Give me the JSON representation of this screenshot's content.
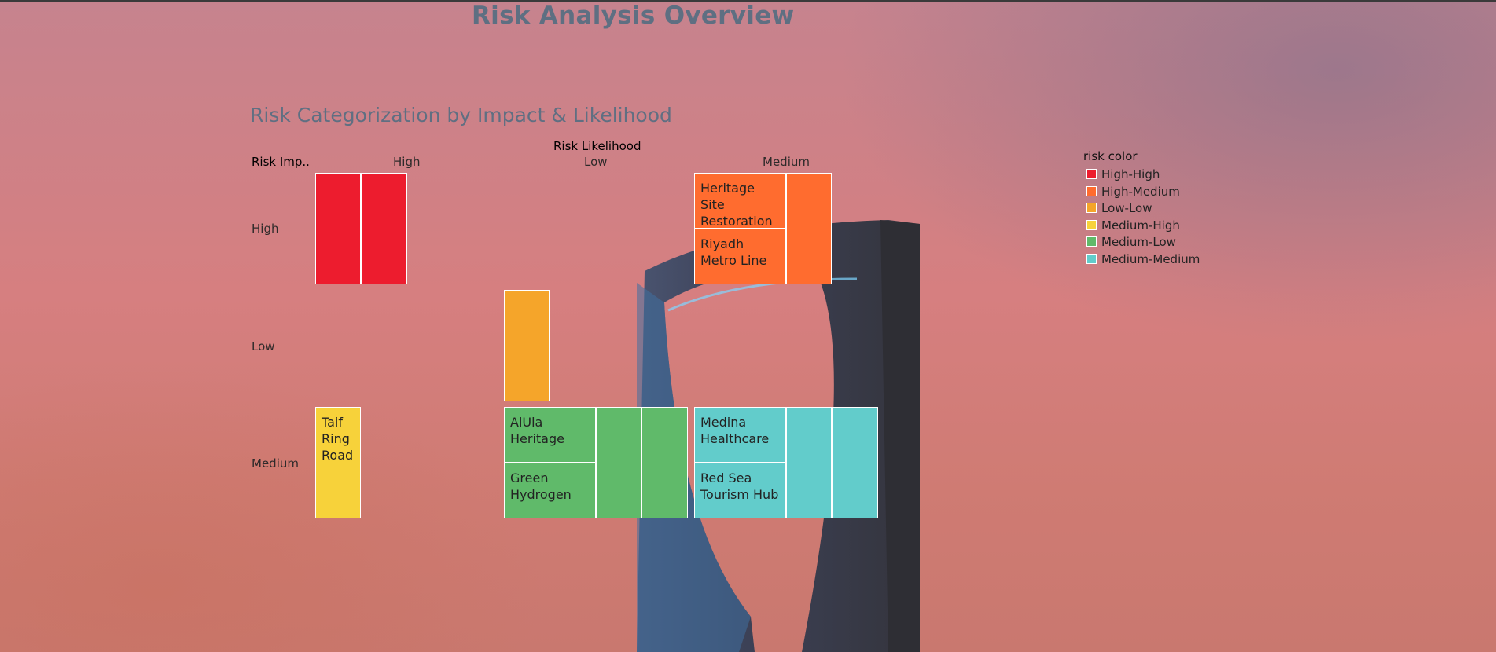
{
  "page": {
    "title": "Risk Analysis Overview"
  },
  "colors": {
    "High-High": "#ed1c2e",
    "High-Medium": "#ff6c2f",
    "Low-Low": "#f5a52a",
    "Medium-High": "#f7d23a",
    "Medium-Low": "#60ba6a",
    "Medium-Medium": "#62cccb"
  },
  "chart_data": {
    "type": "treemap",
    "title": "Risk Categorization by Impact & Likelihood",
    "column_header": "Risk Likelihood",
    "row_header": "Risk Imp..",
    "columns": [
      "High",
      "Low",
      "Medium"
    ],
    "rows": [
      "High",
      "Low",
      "Medium"
    ],
    "cells": [
      {
        "impact": "High",
        "likelihood": "High",
        "color": "High-High",
        "items": [
          {
            "label": ""
          },
          {
            "label": ""
          }
        ]
      },
      {
        "impact": "High",
        "likelihood": "Medium",
        "color": "High-Medium",
        "items": [
          {
            "label": "Heritage Site Restoration"
          },
          {
            "label": "Riyadh Metro Line"
          },
          {
            "label": ""
          }
        ]
      },
      {
        "impact": "Low",
        "likelihood": "Low",
        "color": "Low-Low",
        "items": [
          {
            "label": ""
          }
        ]
      },
      {
        "impact": "Medium",
        "likelihood": "High",
        "color": "Medium-High",
        "items": [
          {
            "label": "Taif Ring Road"
          }
        ]
      },
      {
        "impact": "Medium",
        "likelihood": "Low",
        "color": "Medium-Low",
        "items": [
          {
            "label": "AlUla Heritage"
          },
          {
            "label": "Green Hydrogen"
          },
          {
            "label": ""
          },
          {
            "label": ""
          }
        ]
      },
      {
        "impact": "Medium",
        "likelihood": "Medium",
        "color": "Medium-Medium",
        "items": [
          {
            "label": "Medina Healthcare"
          },
          {
            "label": "Red Sea Tourism Hub"
          },
          {
            "label": ""
          },
          {
            "label": ""
          }
        ]
      }
    ],
    "legend": {
      "title": "risk color",
      "items": [
        "High-High",
        "High-Medium",
        "Low-Low",
        "Medium-High",
        "Medium-Low",
        "Medium-Medium"
      ],
      "placement": "right"
    }
  }
}
